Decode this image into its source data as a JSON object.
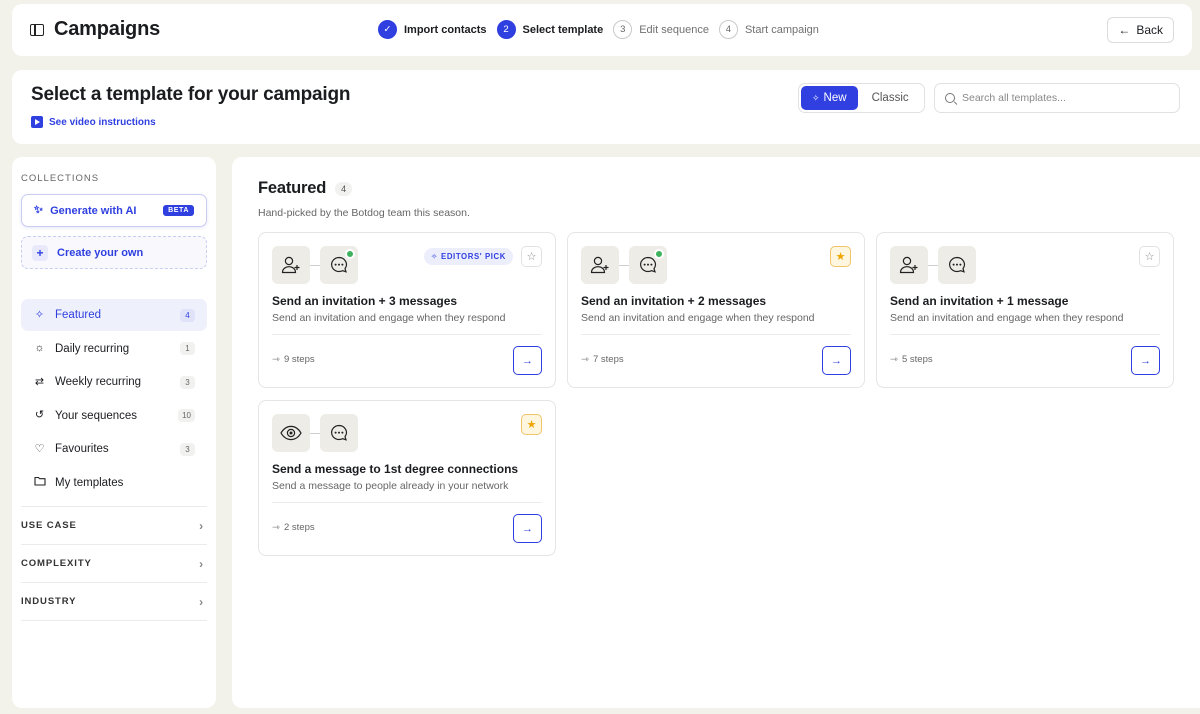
{
  "topbar": {
    "title": "Campaigns",
    "steps": [
      {
        "number": "✓",
        "label": "Import contacts",
        "state": "done"
      },
      {
        "number": "2",
        "label": "Select template",
        "state": "active"
      },
      {
        "number": "3",
        "label": "Edit sequence",
        "state": "todo"
      },
      {
        "number": "4",
        "label": "Start campaign",
        "state": "todo"
      }
    ],
    "back_label": "Back"
  },
  "header": {
    "title": "Select a template for your campaign",
    "video_link": "See video instructions",
    "toggle": {
      "new_label": "New",
      "classic_label": "Classic"
    },
    "search_placeholder": "Search all templates..."
  },
  "sidebar": {
    "collections_label": "COLLECTIONS",
    "generate_ai_label": "Generate with AI",
    "beta_label": "BETA",
    "create_own_label": "Create your own",
    "items": [
      {
        "label": "Featured",
        "count": "4",
        "icon": "sparkle-icon",
        "active": true
      },
      {
        "label": "Daily recurring",
        "count": "1",
        "icon": "sun-icon",
        "active": false
      },
      {
        "label": "Weekly recurring",
        "count": "3",
        "icon": "repeat-icon",
        "active": false
      },
      {
        "label": "Your sequences",
        "count": "10",
        "icon": "history-icon",
        "active": false
      },
      {
        "label": "Favourites",
        "count": "3",
        "icon": "heart-icon",
        "active": false
      },
      {
        "label": "My templates",
        "count": "",
        "icon": "folder-icon",
        "active": false
      }
    ],
    "filters": [
      "USE CASE",
      "COMPLEXITY",
      "INDUSTRY"
    ]
  },
  "main": {
    "section_title": "Featured",
    "section_count": "4",
    "section_subtitle": "Hand-picked by the Botdog team this season.",
    "editors_pick_label": "EDITORS' PICK",
    "cards": [
      {
        "title": "Send an invitation + 3 messages",
        "desc": "Send an invitation and engage when they respond",
        "steps": "9 steps",
        "first_icon": "add-user-icon",
        "favorite": false,
        "editors_pick": true,
        "badge_dot": true
      },
      {
        "title": "Send an invitation + 2 messages",
        "desc": "Send an invitation and engage when they respond",
        "steps": "7 steps",
        "first_icon": "add-user-icon",
        "favorite": true,
        "editors_pick": false,
        "badge_dot": true
      },
      {
        "title": "Send an invitation + 1 message",
        "desc": "Send an invitation and engage when they respond",
        "steps": "5 steps",
        "first_icon": "add-user-icon",
        "favorite": false,
        "editors_pick": false,
        "badge_dot": false
      },
      {
        "title": "Send a message to 1st degree connections",
        "desc": "Send a message to people already in your network",
        "steps": "2 steps",
        "first_icon": "eye-icon",
        "favorite": true,
        "editors_pick": false,
        "badge_dot": false
      }
    ]
  },
  "colors": {
    "accent": "#2f3fe0",
    "page_bg": "#f3f2ea",
    "favorite": "#f0a500",
    "online": "#3db15c"
  }
}
